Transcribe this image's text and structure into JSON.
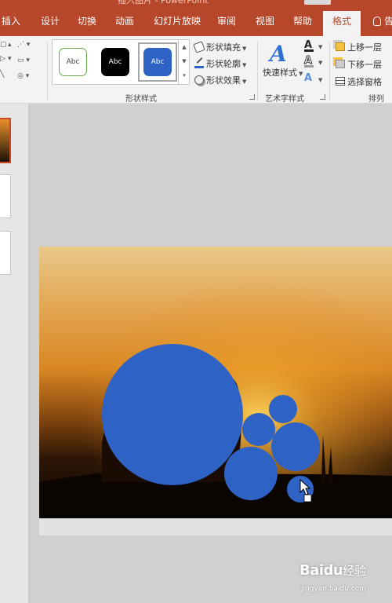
{
  "window": {
    "title": "插入图片 - PowerPoint"
  },
  "tabs": [
    {
      "label": "插入"
    },
    {
      "label": "设计"
    },
    {
      "label": "切换"
    },
    {
      "label": "动画"
    },
    {
      "label": "幻灯片放映"
    },
    {
      "label": "审阅"
    },
    {
      "label": "视图"
    },
    {
      "label": "帮助"
    },
    {
      "label": "格式",
      "active": true
    },
    {
      "label": "告"
    }
  ],
  "ribbon": {
    "shape_styles": {
      "gallery": [
        "Abc",
        "Abc",
        "Abc"
      ],
      "selected_index": 2,
      "commands": [
        {
          "label": "形状填充",
          "icon": "paint-bucket-icon"
        },
        {
          "label": "形状轮廓",
          "icon": "pen-outline-icon"
        },
        {
          "label": "形状效果",
          "icon": "shape-effects-icon"
        }
      ],
      "group_label": "形状样式"
    },
    "wordart_styles": {
      "quick_styles_label": "快速样式",
      "big_icon": "A",
      "text_buttons": [
        "A",
        "A",
        "A"
      ],
      "group_label": "艺术字样式"
    },
    "arrange": {
      "commands": [
        {
          "label": "上移一层",
          "icon": "bring-forward-icon"
        },
        {
          "label": "下移一层",
          "icon": "send-backward-icon"
        },
        {
          "label": "选择窗格",
          "icon": "selection-pane-icon"
        }
      ],
      "group_label": "排列"
    }
  },
  "slide": {
    "background": "sunset photo",
    "shape_color": "#2e63c5"
  },
  "watermark": {
    "logo": "Baidu",
    "cn": "经验",
    "url": "jingyan.baidu.com"
  },
  "colors": {
    "accent": "#b7472a",
    "ribbon_bg": "#f3f3f3",
    "shape_blue": "#2e63c5"
  }
}
